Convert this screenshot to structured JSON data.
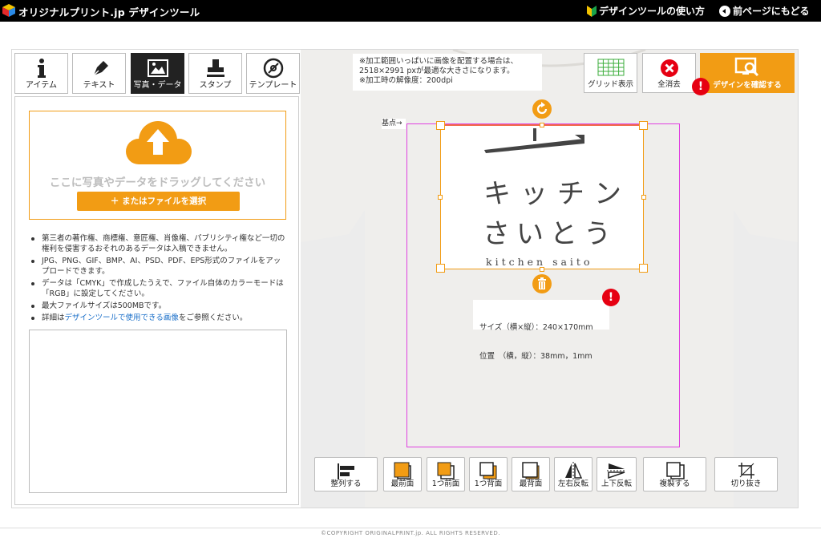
{
  "header": {
    "logo_text": "オリジナルプリント.jp デザインツール",
    "help_link": "デザインツールの使い方",
    "back_link": "前ページにもどる"
  },
  "tabs": [
    {
      "label": "アイテム",
      "icon": "info-icon"
    },
    {
      "label": "テキスト",
      "icon": "pen-icon"
    },
    {
      "label": "写真・データ",
      "icon": "image-icon"
    },
    {
      "label": "スタンプ",
      "icon": "stamp-icon"
    },
    {
      "label": "テンプレート",
      "icon": "template-icon"
    }
  ],
  "active_tab": "写真・データ",
  "upload": {
    "drop_text": "ここに写真やデータをドラッグしてください",
    "select_button": "＋ またはファイルを選択"
  },
  "notes": {
    "n1": "第三者の著作権、商標権、意匠権、肖像権、パブリシティ権など一切の権利を侵害するおそれのあるデータは入稿できません。",
    "n2": "JPG、PNG、GIF、BMP、AI、PSD、PDF、EPS形式のファイルをアップロードできます。",
    "n3": "データは「CMYK」で作成したうえで、ファイル自体のカラーモードは「RGB」に設定してください。",
    "n4": "最大ファイルサイズは500MBです。",
    "n5_prefix": "詳細は",
    "n5_link": "デザインツールで使用できる画像",
    "n5_suffix": "をご参照ください。"
  },
  "canvas_info": {
    "line1": "※加工範囲いっぱいに画像を配置する場合は、",
    "line2": "2518×2991 pxが最適な大きさになります。",
    "line3": "※加工時の解像度：200dpi"
  },
  "toolbar_top": {
    "grid": "グリッド表示",
    "clear": "全消去",
    "confirm": "デザインを確認する"
  },
  "origin_label": "基点→",
  "design": {
    "line1": "キッチン",
    "line2": "さいとう",
    "line3": "kitchen saito"
  },
  "size_info": {
    "size": "サイズ（横×縦）：240×170mm",
    "position": "位置　（横，縦）：38mm，1mm"
  },
  "toolbar_bottom": [
    "整列する",
    "最前面",
    "1つ前面",
    "1つ背面",
    "最背面",
    "左右反転",
    "上下反転",
    "複製する",
    "切り抜き"
  ],
  "footer": "©COPYRIGHT ORIGINALPRINT.jp. ALL RIGHTS RESERVED.",
  "colors": {
    "accent": "#f29c14",
    "warning": "#e60012",
    "print_area": "#e040e0"
  }
}
